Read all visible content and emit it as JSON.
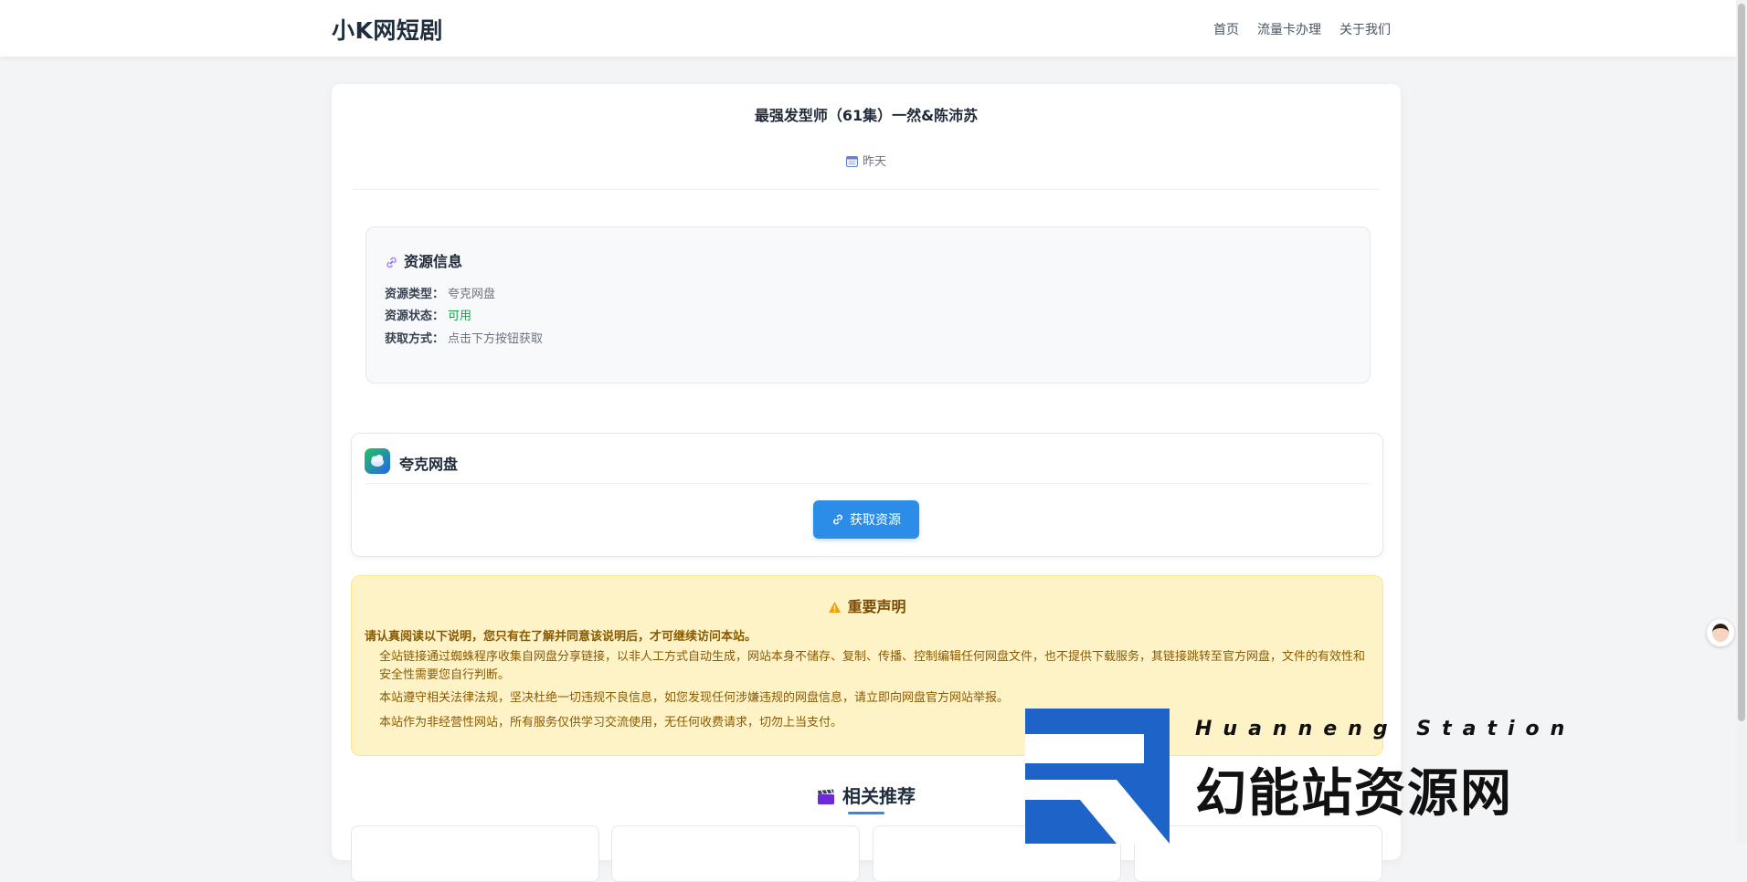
{
  "header": {
    "logo": "小K网短剧",
    "nav": [
      "首页",
      "流量卡办理",
      "关于我们"
    ]
  },
  "post": {
    "title": "最强发型师（61集）一然&陈沛苏",
    "date": "昨天"
  },
  "resource_info": {
    "heading": "资源信息",
    "rows": [
      {
        "label": "资源类型：",
        "value": "夸克网盘"
      },
      {
        "label": "资源状态：",
        "value": "可用"
      },
      {
        "label": "获取方式：",
        "value": "点击下方按钮获取"
      }
    ]
  },
  "pan": {
    "name": "夸克网盘",
    "button": "获取资源"
  },
  "notice": {
    "title": "重要声明",
    "lead": "请认真阅读以下说明，您只有在了解并同意该说明后，才可继续访问本站。",
    "paragraphs": [
      "全站链接通过蜘蛛程序收集自网盘分享链接，以非人工方式自动生成，网站本身不储存、复制、传播、控制编辑任何网盘文件，也不提供下载服务，其链接跳转至官方网盘，文件的有效性和安全性需要您自行判断。",
      "本站遵守相关法律法规，坚决杜绝一切违规不良信息，如您发现任何涉嫌违规的网盘信息，请立即向网盘官方网站举报。",
      "本站作为非经营性网站，所有服务仅供学习交流使用，无任何收费请求，切勿上当支付。"
    ]
  },
  "related": {
    "heading": "相关推荐"
  },
  "watermark": {
    "english": "Huanneng Station",
    "chinese": "幻能站资源网"
  },
  "colors": {
    "accent": "#2b8de8",
    "status_ok": "#16a34a",
    "notice_bg": "#fef3c7",
    "watermark_blue": "#1e64c8"
  }
}
